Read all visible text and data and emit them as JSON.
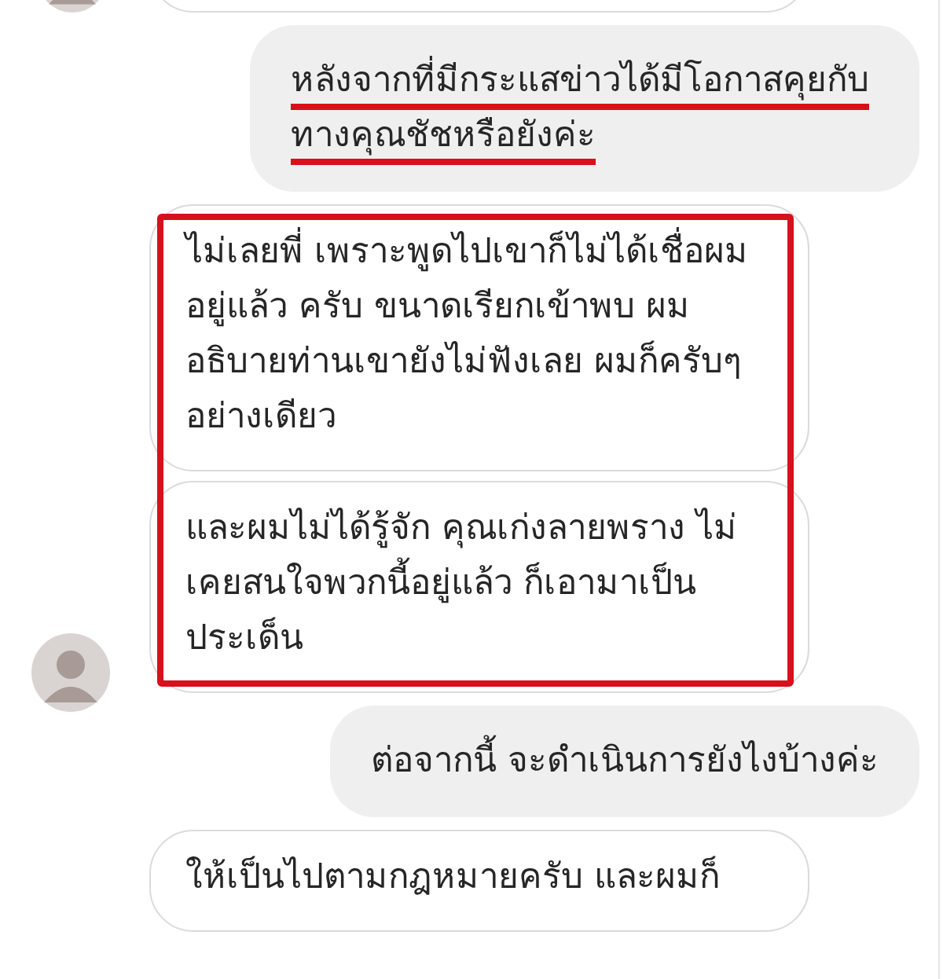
{
  "messages": [
    {
      "kind": "outgoing",
      "text": "หลังจากที่มีกระแสข่าวได้มีโอกาสคุยกับทางคุณชัชหรือยังค่ะ",
      "underlined": true,
      "boxed": false,
      "avatar": false
    },
    {
      "kind": "incoming",
      "text": "ไม่เลยพี่ เพราะพูดไปเขาก็ไม่ได้เชื่อผมอยู่แล้ว ครับ ขนาดเรียกเข้าพบ ผมอธิบายท่านเขายังไม่ฟังเลย ผมก็ครับๆอย่างเดียว",
      "underlined": false,
      "boxed": true,
      "avatar": false
    },
    {
      "kind": "incoming",
      "text": "และผมไม่ได้รู้จัก คุณเก่งลายพราง ไม่เคยสนใจพวกนี้อยู่แล้ว ก็เอามาเป็นประเด็น",
      "underlined": false,
      "boxed": true,
      "avatar": true
    },
    {
      "kind": "outgoing",
      "text": "ต่อจากนี้ จะดำเนินการยังไงบ้างค่ะ",
      "underlined": false,
      "boxed": false,
      "avatar": false
    },
    {
      "kind": "incoming",
      "text": "ให้เป็นไปตามกฎหมายครับ และผมก็",
      "underlined": false,
      "boxed": false,
      "avatar": false
    }
  ]
}
